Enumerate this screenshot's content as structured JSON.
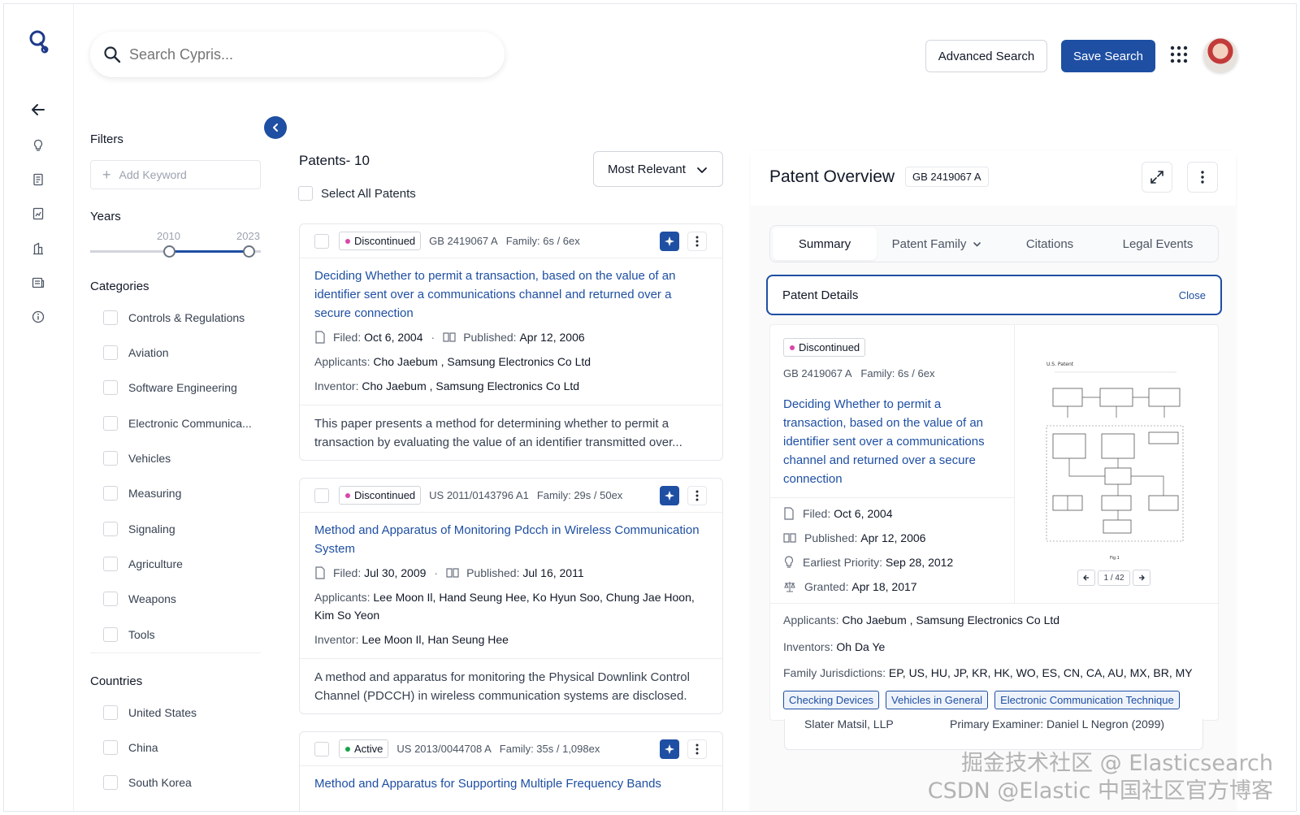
{
  "header": {
    "search_placeholder": "Search Cypris...",
    "advanced_search": "Advanced Search",
    "save_search": "Save Search"
  },
  "filters": {
    "title": "Filters",
    "add_keyword": "Add Keyword",
    "years_label": "Years",
    "year_min": "2010",
    "year_max": "2023",
    "categories_label": "Categories",
    "categories": [
      "Controls & Regulations",
      "Aviation",
      "Software Engineering",
      "Electronic Communica...",
      "Vehicles",
      "Measuring",
      "Signaling",
      "Agriculture",
      "Weapons",
      "Tools"
    ],
    "countries_label": "Countries",
    "countries": [
      "United States",
      "China",
      "South Korea"
    ]
  },
  "list": {
    "title": "Patents- 10",
    "select_all": "Select All Patents",
    "sort": "Most Relevant",
    "cards": [
      {
        "status": "Discontinued",
        "status_color": "#d946a8",
        "id": "GB 2419067 A",
        "family": "Family: 6s / 6ex",
        "title": "Deciding Whether to permit a transaction, based on the value of an identifier sent over a communications channel and returned over a secure connection",
        "filed_label": "Filed:",
        "filed": "Oct 6, 2004",
        "published_label": "Published:",
        "published": "Apr 12, 2006",
        "applicants_label": "Applicants:",
        "applicants": "Cho Jaebum , Samsung Electronics Co Ltd",
        "inventor_label": "Inventor:",
        "inventor": "Cho Jaebum , Samsung Electronics Co Ltd",
        "abstract": "This paper presents a method for determining whether to permit a transaction by evaluating the value of an identifier transmitted over..."
      },
      {
        "status": "Discontinued",
        "status_color": "#d946a8",
        "id": "US 2011/0143796 A1",
        "family": "Family: 29s / 50ex",
        "title": "Method and Apparatus of Monitoring Pdcch in Wireless Communication System",
        "filed_label": "Filed:",
        "filed": "Jul 30, 2009",
        "published_label": "Published:",
        "published": "Jul 16, 2011",
        "applicants_label": "Applicants:",
        "applicants": "Lee Moon Il, Hand Seung Hee, Ko Hyun Soo, Chung Jae Hoon, Kim So Yeon",
        "inventor_label": "Inventor:",
        "inventor": "Lee Moon Il, Han Seung Hee",
        "abstract": "A method and apparatus for monitoring the Physical Downlink Control Channel (PDCCH) in wireless communication systems are disclosed."
      },
      {
        "status": "Active",
        "status_color": "#16a34a",
        "id": "US 2013/0044708 A",
        "family": "Family: 35s / 1,098ex",
        "title": "Method and Apparatus for Supporting Multiple Frequency Bands"
      }
    ]
  },
  "overview": {
    "title": "Patent Overview",
    "id": "GB 2419067 A",
    "tabs": [
      "Summary",
      "Patent Family",
      "Citations",
      "Legal Events"
    ],
    "details_title": "Patent Details",
    "close": "Close",
    "status": "Discontinued",
    "status_color": "#d946a8",
    "family": "Family: 6s / 6ex",
    "patent_title": "Deciding Whether to permit a transaction, based on the value of an identifier sent over a communications channel and returned over a secure connection",
    "filed_label": "Filed:",
    "filed": "Oct 6, 2004",
    "published_label": "Published:",
    "published": "Apr 12, 2006",
    "priority_label": "Earliest Priority:",
    "priority": "Sep 28, 2012",
    "granted_label": "Granted:",
    "granted": "Apr 18, 2017",
    "applicants_label": "Applicants:",
    "applicants": "Cho Jaebum , Samsung Electronics Co Ltd",
    "inventors_label": "Inventors:",
    "inventors": "Oh Da Ye",
    "jurisdictions_label": "Family Jurisdictions:",
    "jurisdictions": "EP, US, HU, JP, KR, HK, WO, ES, CN, CA, AU, MX, BR, MY",
    "tags": [
      "Checking Devices",
      "Vehicles in General",
      "Electronic Communication Technique"
    ],
    "figure_header_left": "U.S. Patent",
    "figure_caption": "Fig.1",
    "figure_page": "1 / 42",
    "peek_left": "Slater Matsil, LLP",
    "peek_right": "Primary Examiner: Daniel L Negron (2099)"
  },
  "watermark": {
    "line1": "CSDN @Elastic 中国社区官方博客",
    "line2": "掘金技术社区 @ Elasticsearch"
  }
}
